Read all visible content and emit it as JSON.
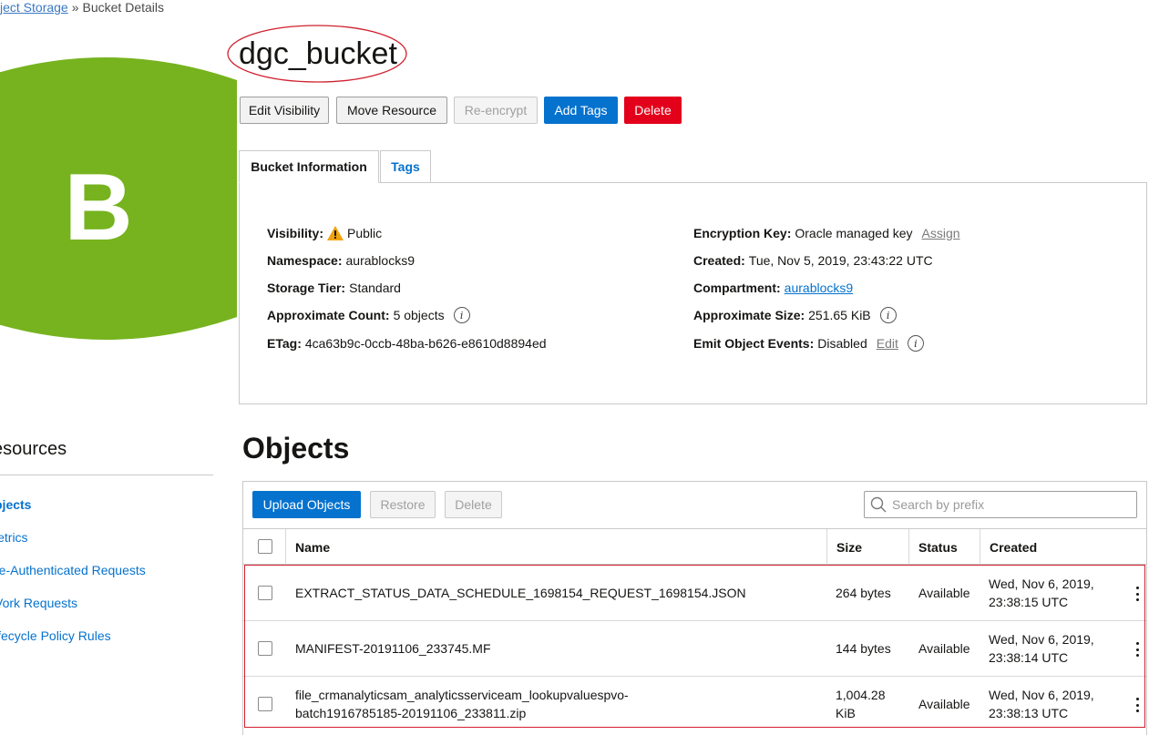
{
  "breadcrumb": {
    "parent": "ject Storage",
    "separator": "»",
    "current": "Bucket Details"
  },
  "logo": {
    "letter": "B",
    "color": "#76b31e"
  },
  "bucket": {
    "name": "dgc_bucket"
  },
  "actions": {
    "edit_visibility": "Edit Visibility",
    "move_resource": "Move Resource",
    "re_encrypt": "Re-encrypt",
    "add_tags": "Add Tags",
    "delete": "Delete"
  },
  "tabs": {
    "bucket_information": "Bucket Information",
    "tags": "Tags"
  },
  "info": {
    "visibility": {
      "label": "Visibility:",
      "value": "Public"
    },
    "namespace": {
      "label": "Namespace:",
      "value": "aurablocks9"
    },
    "storage_tier": {
      "label": "Storage Tier:",
      "value": "Standard"
    },
    "approx_count": {
      "label": "Approximate Count:",
      "value": "5 objects"
    },
    "etag": {
      "label": "ETag:",
      "value": "4ca63b9c-0ccb-48ba-b626-e8610d8894ed"
    },
    "encryption_key": {
      "label": "Encryption Key:",
      "value": "Oracle managed key",
      "action": "Assign"
    },
    "created": {
      "label": "Created:",
      "value": "Tue, Nov 5, 2019, 23:43:22 UTC"
    },
    "compartment": {
      "label": "Compartment:",
      "value": "aurablocks9"
    },
    "approx_size": {
      "label": "Approximate Size:",
      "value": "251.65 KiB"
    },
    "emit_events": {
      "label": "Emit Object Events:",
      "value": "Disabled",
      "action": "Edit"
    }
  },
  "resources": {
    "title": "esources",
    "items": [
      {
        "label": "bjects",
        "active": true
      },
      {
        "label": "letrics",
        "active": false
      },
      {
        "label": "re-Authenticated Requests",
        "active": false
      },
      {
        "label": "Vork Requests",
        "active": false
      },
      {
        "label": "ifecycle Policy Rules",
        "active": false
      }
    ]
  },
  "objects": {
    "title": "Objects",
    "upload": "Upload Objects",
    "restore": "Restore",
    "delete": "Delete",
    "search_placeholder": "Search by prefix",
    "columns": {
      "name": "Name",
      "size": "Size",
      "status": "Status",
      "created": "Created"
    },
    "rows": [
      {
        "name_line1": "EXTRACT_STATUS_DATA_SCHEDULE_1698154_REQUEST_1698154.JSON",
        "name_line2": "",
        "size_line1": "264 bytes",
        "size_line2": "",
        "status": "Available",
        "created_line1": "Wed, Nov 6, 2019,",
        "created_line2": "23:38:15 UTC"
      },
      {
        "name_line1": "MANIFEST-20191106_233745.MF",
        "name_line2": "",
        "size_line1": "144 bytes",
        "size_line2": "",
        "status": "Available",
        "created_line1": "Wed, Nov 6, 2019,",
        "created_line2": "23:38:14 UTC"
      },
      {
        "name_line1": "file_crmanalyticsam_analyticsserviceam_lookupvaluespvo-",
        "name_line2": "batch1916785185-20191106_233811.zip",
        "size_line1": "1,004.28",
        "size_line2": "KiB",
        "status": "Available",
        "created_line1": "Wed, Nov 6, 2019,",
        "created_line2": "23:38:13 UTC"
      }
    ]
  },
  "colors": {
    "primary": "#0572ce",
    "danger": "#e3001b",
    "annotation": "#d0202e",
    "warning": "#f0a30a"
  }
}
